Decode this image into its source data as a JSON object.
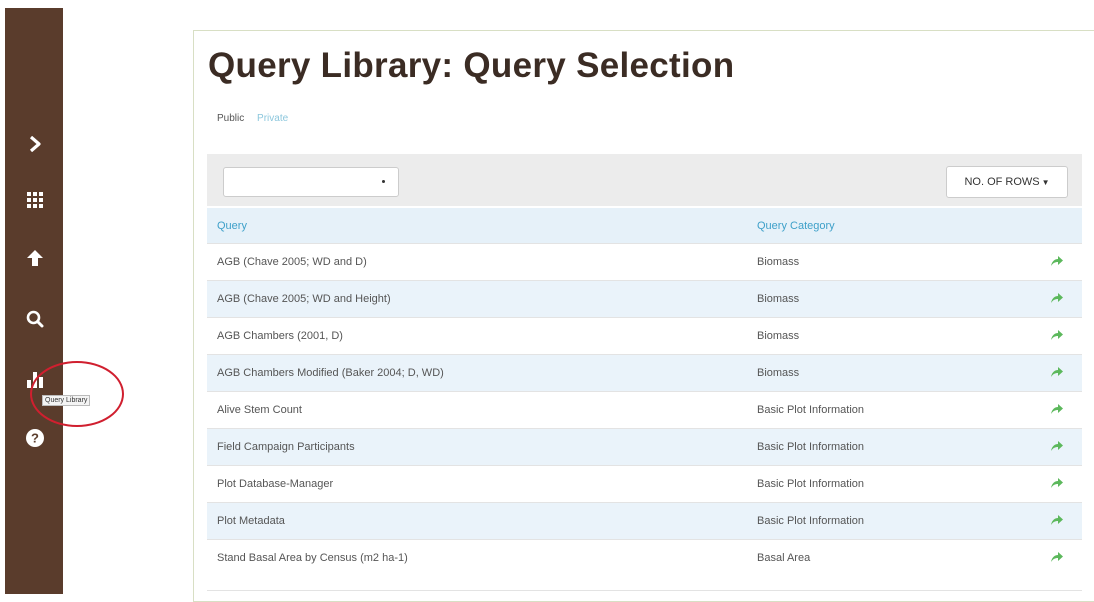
{
  "page": {
    "title": "Query Library: Query Selection",
    "tabs": [
      {
        "label": "Public"
      },
      {
        "label": "Private"
      }
    ]
  },
  "sidebar": {
    "icons": [
      "chevron-right-icon",
      "grid-icon",
      "cloud-upload-icon",
      "search-icon",
      "bar-chart-icon",
      "help-icon"
    ],
    "tooltip": "Query Library",
    "colors": {
      "background": "#5a3c2c",
      "highlight_circle": "#d01f2f"
    }
  },
  "toolbar": {
    "select_value": "",
    "rows_button": "NO. OF ROWS"
  },
  "table": {
    "headers": {
      "query": "Query",
      "category": "Query Category"
    },
    "rows": [
      {
        "query": "AGB (Chave 2005; WD and D)",
        "category": "Biomass"
      },
      {
        "query": "AGB (Chave 2005; WD and Height)",
        "category": "Biomass"
      },
      {
        "query": "AGB Chambers (2001, D)",
        "category": "Biomass"
      },
      {
        "query": "AGB Chambers Modified (Baker 2004; D, WD)",
        "category": "Biomass"
      },
      {
        "query": "Alive Stem Count",
        "category": "Basic Plot Information"
      },
      {
        "query": "Field Campaign Participants",
        "category": "Basic Plot Information"
      },
      {
        "query": "Plot Database-Manager",
        "category": "Basic Plot Information"
      },
      {
        "query": "Plot Metadata",
        "category": "Basic Plot Information"
      },
      {
        "query": "Stand Basal Area by Census (m2 ha-1)",
        "category": "Basal Area"
      }
    ],
    "row_action_icon": "share-arrow-icon",
    "colors": {
      "link": "#3ea0c9",
      "arrow": "#5cb85c",
      "alt_row": "#eaf3fa"
    }
  }
}
